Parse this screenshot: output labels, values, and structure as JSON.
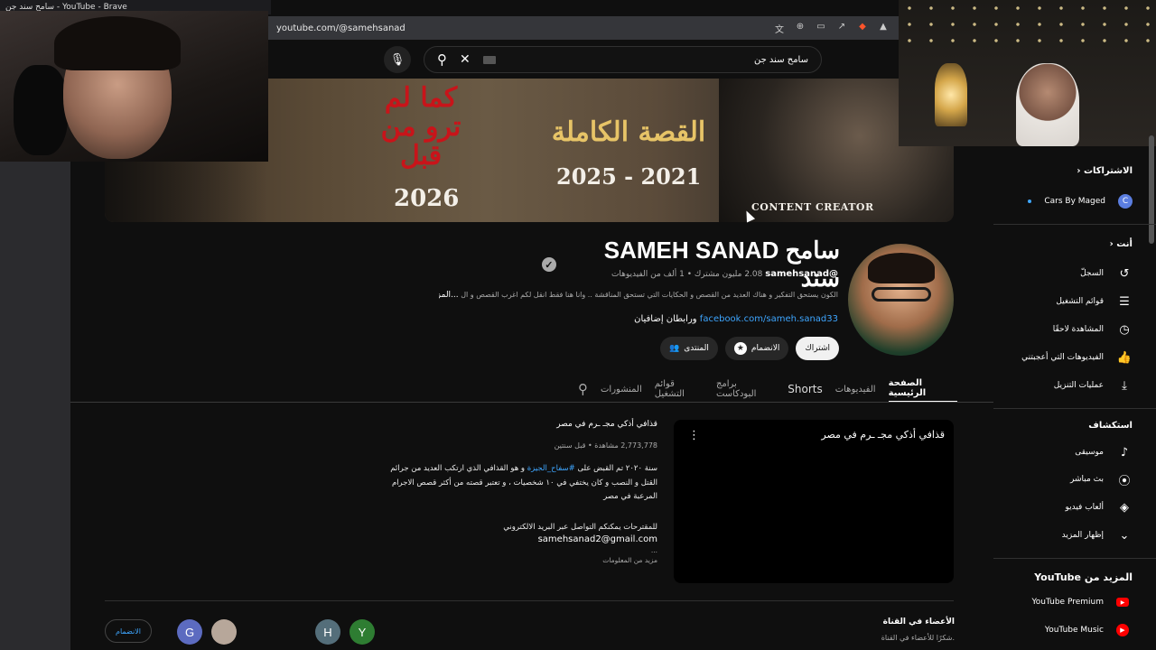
{
  "window": {
    "title": "سامح سند جن - YouTube - Brave"
  },
  "browser": {
    "url": "youtube.com/@samehsanad"
  },
  "search": {
    "value": "سامح سند جن"
  },
  "banner": {
    "red_text": "كما لم ترو من قبل",
    "year": "2026",
    "story": "القصة الكاملة",
    "range": "2025 - 2021",
    "creator": "CONTENT CREATOR"
  },
  "channel": {
    "name": "SAMEH SANAD سامح سند",
    "handle": "@samehsanad",
    "stats": "‏2.08 مليون مشترك ‏• 1 ألف من الفيديوهات",
    "description": "الكون يستحق التفكير و هناك العديد من القصص و الحكايات التي تستحق المناقشة .. وانا هنا فقط انقل لكم اغرب القصص و ال",
    "more": "...المزيد",
    "link": "facebook.com/sameh.sanad33",
    "link_suffix": "ورابطان إضافيان",
    "subscribe_label": "اشتراك",
    "join_label": "الانضمام",
    "community_label": "المنتدى"
  },
  "tabs": [
    "الصفحة الرئيسية",
    "الفيديوهات",
    "Shorts",
    "برامج البودكاست",
    "قوائم التشغيل",
    "المنشورات"
  ],
  "featured": {
    "player_title": "قذافي أذكي مجـ ـرم في مصر",
    "title": "قذافي أذكي مجـ ـرم في مصر",
    "meta": "2,773,778 مشاهدة • قبل سنتين",
    "desc_pre": "سنة ٢٠٢٠ تم القبض على ",
    "hashtag": "#سفاح_الجيزة",
    "desc_post": " و هو القذافي الذي ارتكب العديد من جرائم القتل و النصب و كان يختفي في ١٠ شخصيات ، و تعتبر قصته من أكثر قصص الاجرام المرعبة في مصر",
    "contact": "للمقترحات يمكنكم التواصل عبر البريد الالكتروني",
    "email": "samehsanad2@gmail.com",
    "ellipsis": "...",
    "more_info": "مزيد من المعلومات"
  },
  "members": {
    "title": "الأعضاء في القناة",
    "subtitle": "شكرًا للأعضاء في القناة.",
    "join_label": "الانضمام",
    "avatars": [
      "G",
      "H",
      "Y"
    ]
  },
  "sidebar": {
    "subscriptions_title": "الاشتراكات",
    "cars_channel": "Cars By Maged",
    "you_title": "أنت",
    "you_items": [
      {
        "label": "السجلّ",
        "icon": "history-icon"
      },
      {
        "label": "قوائم التشغيل",
        "icon": "playlist-icon"
      },
      {
        "label": "المشاهدة لاحقًا",
        "icon": "clock-icon"
      },
      {
        "label": "الفيديوهات التي أعجبتني",
        "icon": "thumbs-up-icon"
      },
      {
        "label": "عمليات التنزيل",
        "icon": "download-icon"
      }
    ],
    "explore_title": "استكشاف",
    "explore_items": [
      {
        "label": "موسيقى",
        "icon": "music-icon"
      },
      {
        "label": "بث مباشر",
        "icon": "live-icon"
      },
      {
        "label": "ألعاب فيديو",
        "icon": "gaming-icon"
      },
      {
        "label": "إظهار المزيد",
        "icon": "chevron-down-icon"
      }
    ],
    "more_title": "المزيد من YouTube",
    "premium": "YouTube Premium",
    "music": "YouTube Music"
  }
}
